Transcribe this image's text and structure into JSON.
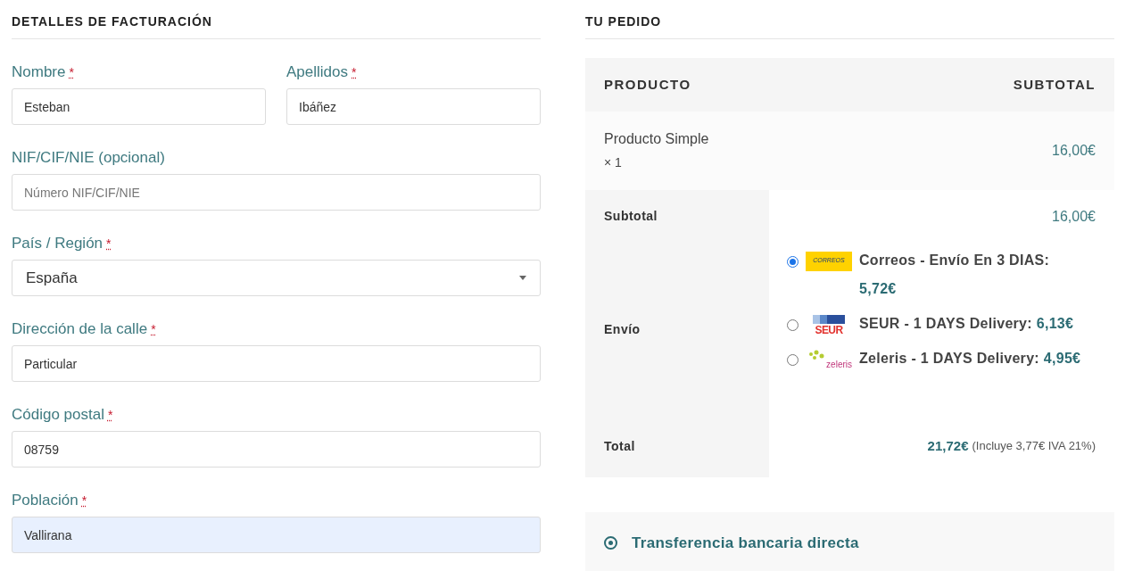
{
  "billing": {
    "title": "DETALLES DE FACTURACIÓN",
    "fields": [
      {
        "label": "Nombre",
        "required": true,
        "kind": "text",
        "value": "Esteban",
        "autofilled": false,
        "half": true
      },
      {
        "label": "Apellidos",
        "required": true,
        "kind": "text",
        "value": "Ibáñez",
        "autofilled": false,
        "half": true
      },
      {
        "label": "NIF/CIF/NIE (opcional)",
        "required": false,
        "kind": "text",
        "placeholder": "Número NIF/CIF/NIE",
        "autofilled": false,
        "half": false
      },
      {
        "label": "País / Región",
        "required": true,
        "kind": "select",
        "value": "España",
        "autofilled": false,
        "half": false
      },
      {
        "label": "Dirección de la calle",
        "required": true,
        "kind": "text",
        "value": "Particular",
        "autofilled": false,
        "half": false
      },
      {
        "label": "Código postal",
        "required": true,
        "kind": "text",
        "value": "08759",
        "autofilled": false,
        "half": false
      },
      {
        "label": "Población",
        "required": true,
        "kind": "text",
        "value": "Vallirana",
        "autofilled": true,
        "half": false
      }
    ],
    "required_mark": "*"
  },
  "order": {
    "title": "TU PEDIDO",
    "columns": [
      "PRODUCTO",
      "SUBTOTAL"
    ],
    "items": [
      {
        "name": "Producto Simple",
        "quantity": "× 1",
        "price": "16,00€"
      }
    ],
    "subtotal": {
      "label": "Subtotal",
      "value": "16,00€"
    },
    "shipping": {
      "label": "Envío",
      "options": [
        {
          "selected": true,
          "kind": "correos",
          "logo_text": "CORREOS",
          "label": "Correos - Envío En 3 DIAS:",
          "price": "5,72€"
        },
        {
          "selected": false,
          "kind": "seur",
          "logo_text": "SEUR",
          "label": "SEUR - 1 DAYS Delivery:",
          "price": "6,13€"
        },
        {
          "selected": false,
          "kind": "zeleris",
          "logo_text": "zeleris",
          "label": "Zeleris - 1 DAYS Delivery:",
          "price": "4,95€"
        }
      ]
    },
    "total": {
      "label": "Total",
      "value": "21,72€",
      "tax_note": "(Incluye 3,77€ IVA 21%)"
    }
  },
  "payment": {
    "methods": [
      {
        "label": "Transferencia bancaria directa",
        "selected": true
      }
    ]
  }
}
